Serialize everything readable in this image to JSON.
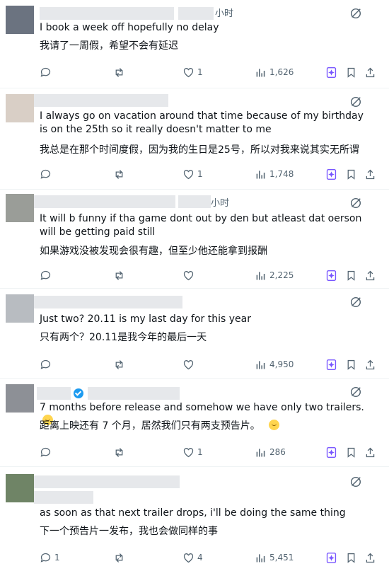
{
  "posts": [
    {
      "time": "小时",
      "text_en": "I book a week off hopefully no delay",
      "text_zh": "我请了一周假，希望不会有延迟",
      "replies": "",
      "reposts": "",
      "likes": "1",
      "views": "1,626"
    },
    {
      "time": "",
      "text_en": "I always go on vacation around that time because of my birthday is on the 25th so it really doesn't matter to me",
      "text_zh": "我总是在那个时间度假，因为我的生日是25号，所以对我来说其实无所谓",
      "replies": "",
      "reposts": "",
      "likes": "1",
      "views": "1,748"
    },
    {
      "time": "小时",
      "text_en": "It will b funny if tha game dont out by den but atleast dat oerson will be getting paid still",
      "text_zh": "如果游戏没被发现会很有趣，但至少他还能拿到报酬",
      "replies": "",
      "reposts": "",
      "likes": "",
      "views": "2,225"
    },
    {
      "time": "",
      "text_en": "Just two? 20.11 is my last day for this year",
      "text_zh": "只有两个？20.11是我今年的最后一天",
      "replies": "",
      "reposts": "",
      "likes": "",
      "views": "4,950"
    },
    {
      "time": "",
      "text_en": "7 months before release and somehow we have only two trailers.",
      "text_zh": "距离上映还有 7 个月，居然我们只有两支预告片。",
      "replies": "",
      "reposts": "",
      "likes": "1",
      "views": "286"
    },
    {
      "time": "",
      "text_en": "as soon as that next trailer drops, i'll be doing the same thing",
      "text_zh": "下一个预告片一发布，我也会做同样的事",
      "replies": "1",
      "reposts": "",
      "likes": "4",
      "views": "5,451"
    }
  ],
  "icons": {
    "reply": "reply-icon",
    "repost": "repost-icon",
    "like": "heart-icon",
    "views": "views-icon",
    "grok": "grok-icon",
    "bookmark": "bookmark-icon",
    "share": "share-icon",
    "corner": "grok-corner-icon"
  },
  "colors": {
    "text": "#0f1419",
    "muted": "#536471",
    "accent": "#7856ff",
    "verified": "#1d9bf0"
  }
}
